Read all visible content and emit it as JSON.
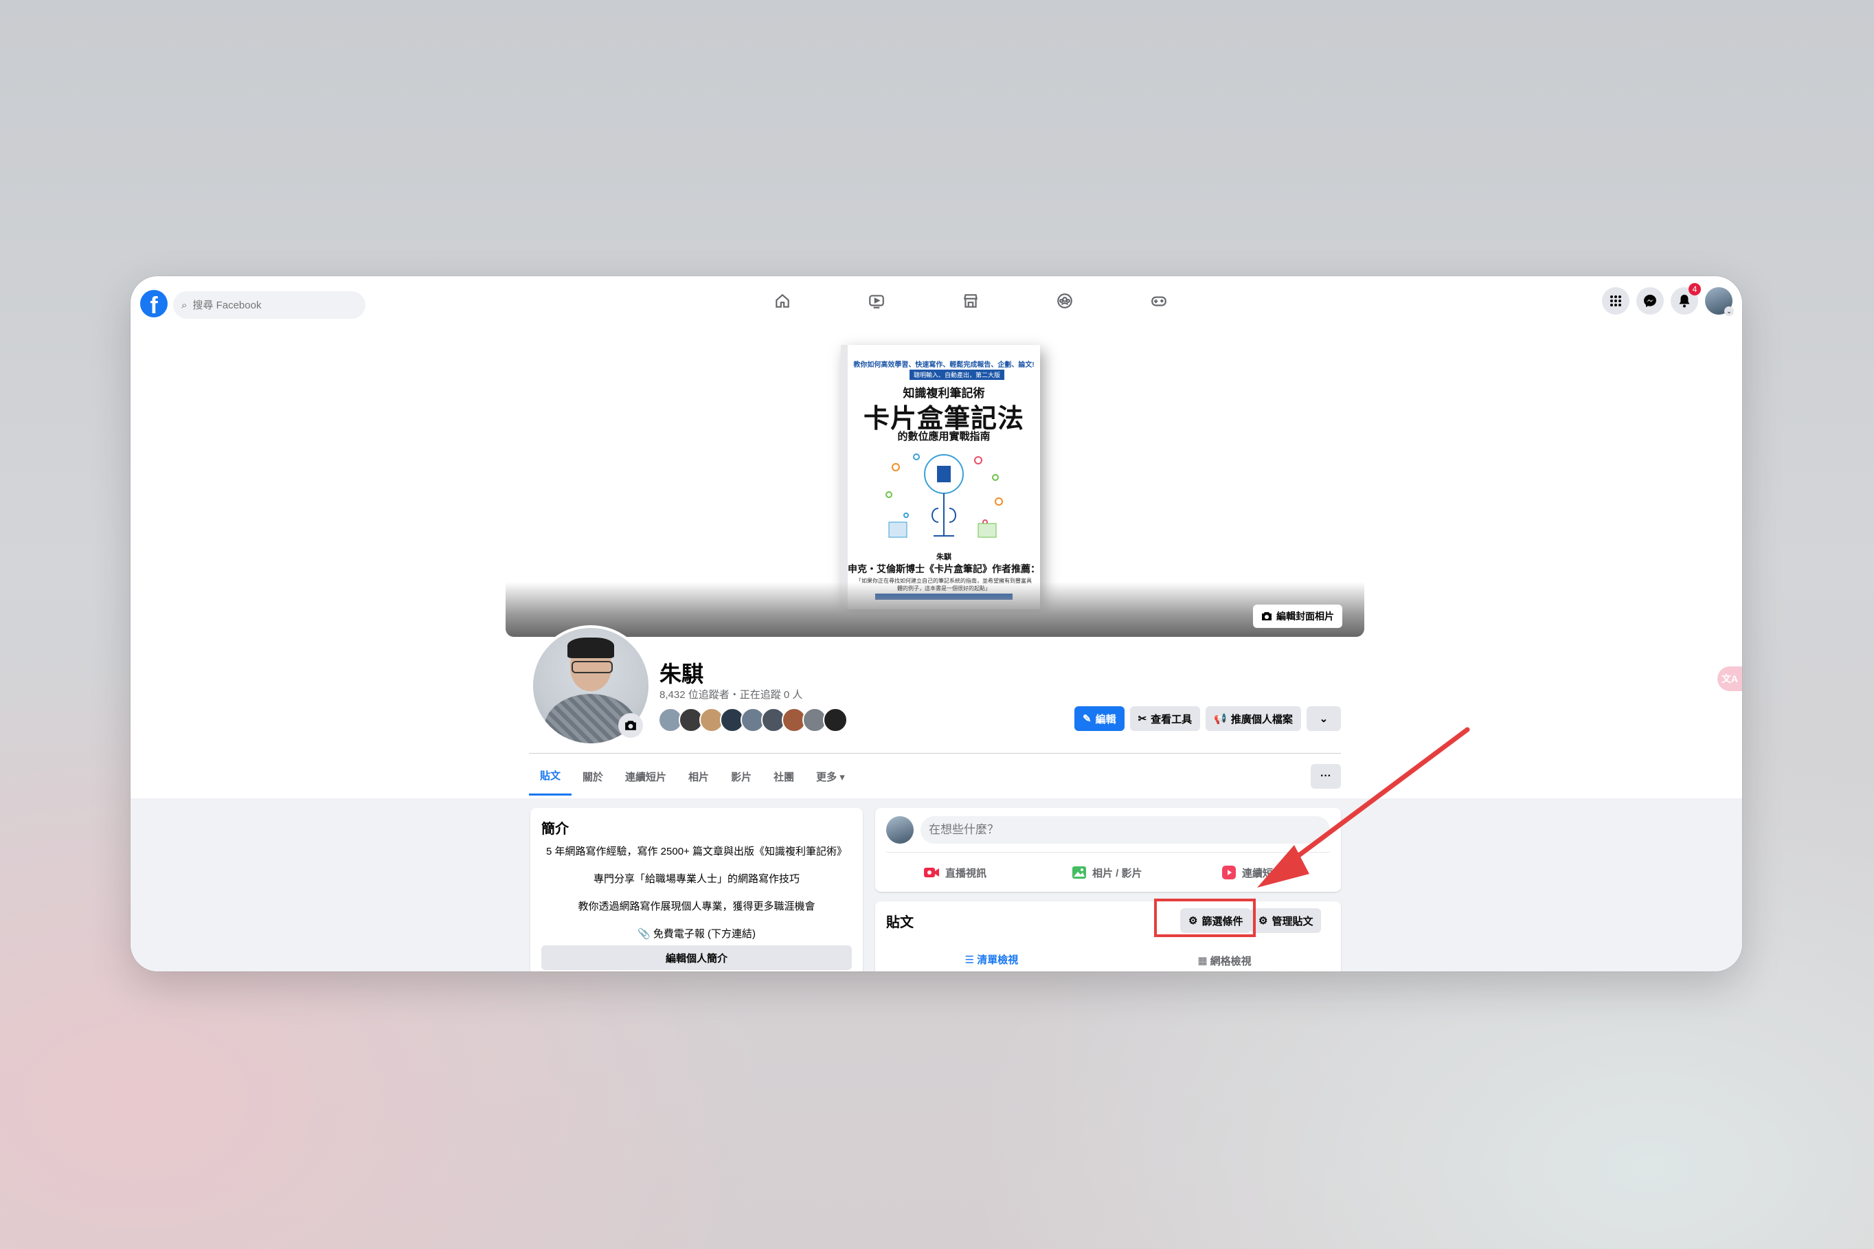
{
  "nav": {
    "logo": "f",
    "search_placeholder": "搜尋 Facebook",
    "notification_count": "4"
  },
  "cover": {
    "edit_cover_label": "編輯封面相片",
    "book": {
      "tagline": "教你如何高效學習、快速寫作、輕鬆完成報告、企劃、論文!",
      "edition": "聰明輸入、自動產出，第二大版",
      "series": "知識複利筆記術",
      "title": "卡片盒筆記法",
      "subtitle": "的數位應用實戰指南",
      "author": "朱騏",
      "endorse": "申克・艾倫斯博士《卡片盒筆記》作者推薦：",
      "quote": "「如果你正在尋找如何建立自己的筆記系統的指南，並希望擁有到豐富具體的例子，這本書是一個很好的起點」"
    }
  },
  "profile": {
    "name": "朱騏",
    "followers": "8,432 位追蹤者・正在追蹤 0 人",
    "edit_label": "編輯",
    "tools_label": "查看工具",
    "promote_label": "推廣個人檔案"
  },
  "tabs": [
    "貼文",
    "關於",
    "連續短片",
    "相片",
    "影片",
    "社團",
    "更多 ▾"
  ],
  "tab_more": "···",
  "intro": {
    "title": "簡介",
    "lines": [
      "5 年網路寫作經驗，寫作 2500+ 篇文章與出版《知識複利筆記術》",
      "專門分享「給職場專業人士」的網路寫作技巧",
      "教你透過網路寫作展現個人專業，獲得更多職涯機會",
      "📎 免費電子報 (下方連結)"
    ],
    "edit_label": "編輯個人簡介"
  },
  "composer": {
    "placeholder": "在想些什麼？",
    "actions": [
      "直播視訊",
      "相片 / 影片",
      "連續短片"
    ]
  },
  "posts": {
    "title": "貼文",
    "filter_label": "篩選條件",
    "manage_label": "管理貼文",
    "list_view": "清單檢視",
    "grid_view": "網格檢視"
  },
  "side_pill": "文A",
  "colors": {
    "facebook_blue": "#1877f2",
    "annotation_red": "#e53e3e"
  }
}
